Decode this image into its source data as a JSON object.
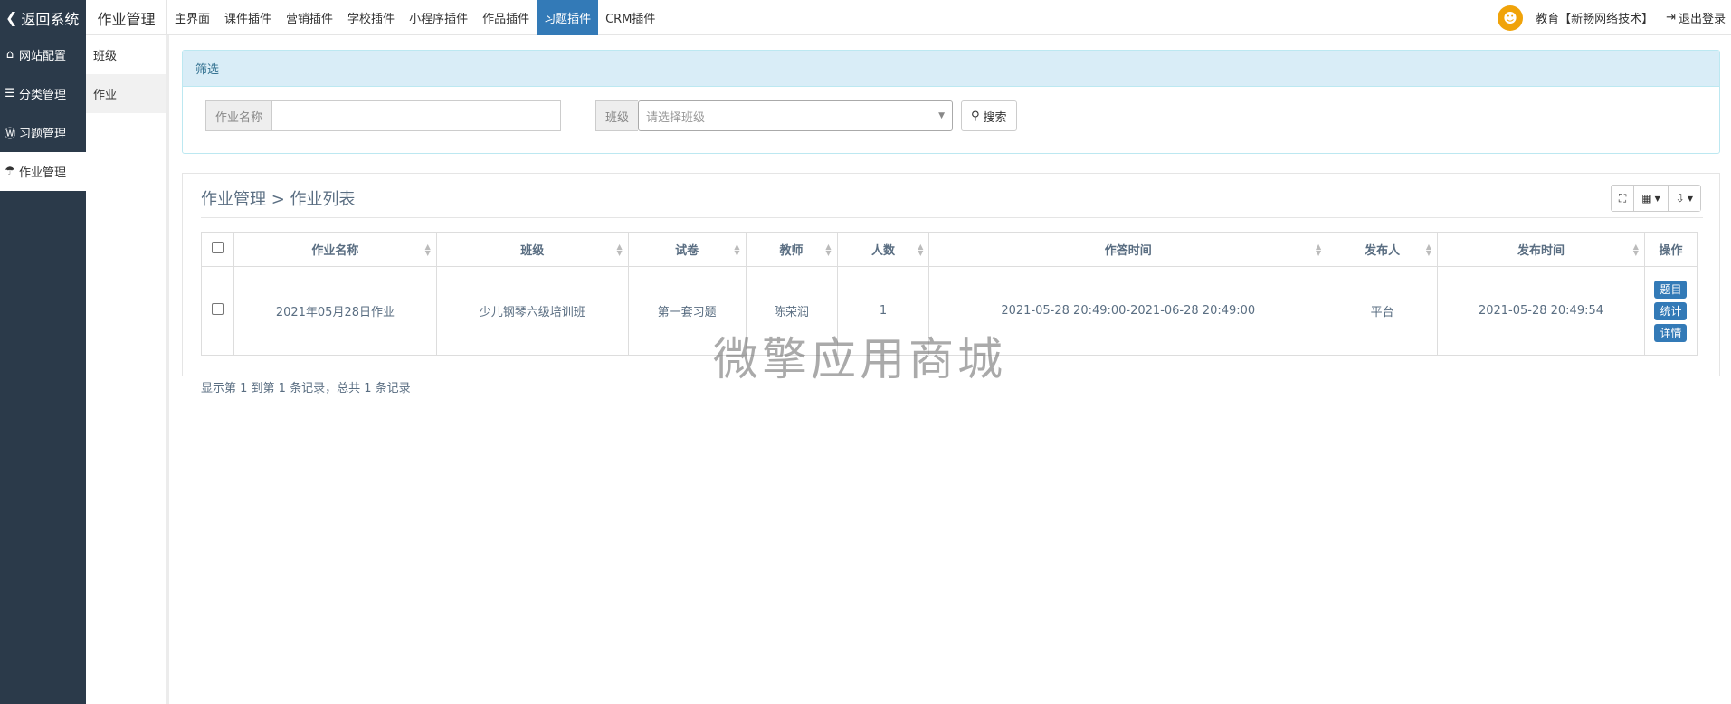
{
  "topbar": {
    "back_label": "返回系统",
    "module_title": "作业管理",
    "nav": [
      {
        "label": "主界面",
        "active": false
      },
      {
        "label": "课件插件",
        "active": false
      },
      {
        "label": "营销插件",
        "active": false
      },
      {
        "label": "学校插件",
        "active": false
      },
      {
        "label": "小程序插件",
        "active": false
      },
      {
        "label": "作品插件",
        "active": false
      },
      {
        "label": "习题插件",
        "active": true
      },
      {
        "label": "CRM插件",
        "active": false
      }
    ],
    "user": "教育【新畅网络技术】",
    "logout": "退出登录"
  },
  "sidebar": {
    "items": [
      {
        "label": "网站配置",
        "icon": "home-icon"
      },
      {
        "label": "分类管理",
        "icon": "list-icon"
      },
      {
        "label": "习题管理",
        "icon": "wordpress-icon"
      },
      {
        "label": "作业管理",
        "icon": "umbrella-icon"
      }
    ]
  },
  "submenu": {
    "items": [
      {
        "label": "班级"
      },
      {
        "label": "作业"
      }
    ]
  },
  "filter": {
    "title": "筛选",
    "name_label": "作业名称",
    "name_value": "",
    "class_label": "班级",
    "class_placeholder": "请选择班级",
    "search_label": "搜索"
  },
  "list": {
    "title": "作业管理 > 作业列表",
    "columns": [
      "作业名称",
      "班级",
      "试卷",
      "教师",
      "人数",
      "作答时间",
      "发布人",
      "发布时间",
      "操作"
    ],
    "rows": [
      {
        "name": "2021年05月28日作业",
        "class": "少儿钢琴六级培训班",
        "paper": "第一套习题",
        "teacher": "陈荣润",
        "count": "1",
        "answer_time": "2021-05-28 20:49:00-2021-06-28 20:49:00",
        "publisher": "平台",
        "publish_time": "2021-05-28 20:49:54",
        "actions": [
          "题目",
          "统计",
          "详情"
        ]
      }
    ],
    "pager_info": "显示第 1 到第 1 条记录，总共 1 条记录"
  },
  "watermark": "微擎应用商城",
  "colors": {
    "sidebar_bg": "#2b3a4a",
    "accent": "#337ab7",
    "filter_head_bg": "#d9edf7"
  }
}
